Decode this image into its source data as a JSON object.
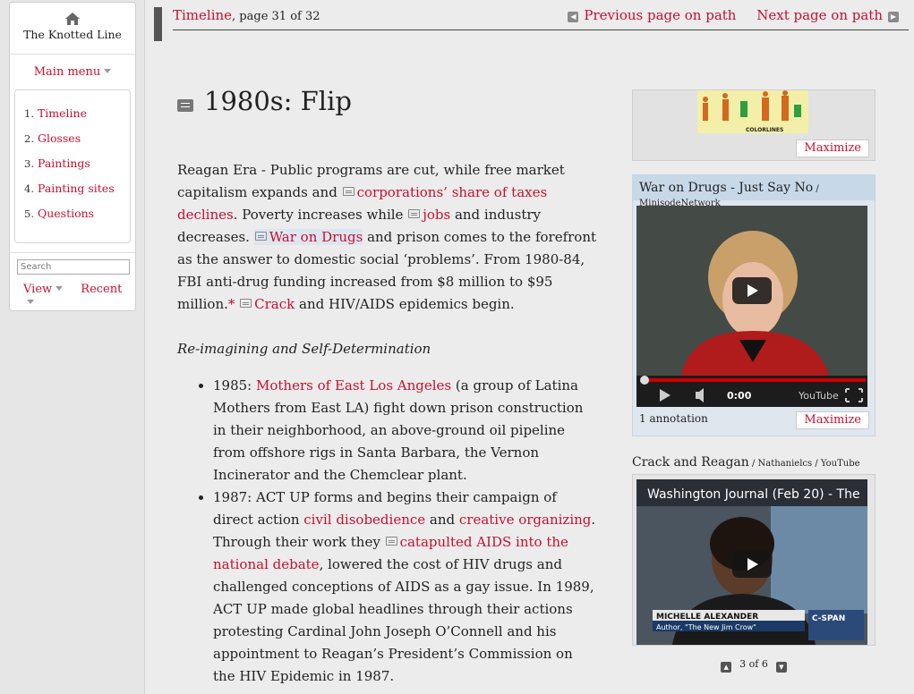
{
  "site": {
    "title": "The Knotted Line",
    "home_icon": "home-icon"
  },
  "sidebar": {
    "main_menu_label": "Main menu",
    "items": [
      {
        "num": "1.",
        "label": "Timeline"
      },
      {
        "num": "2.",
        "label": "Glosses"
      },
      {
        "num": "3.",
        "label": "Paintings"
      },
      {
        "num": "4.",
        "label": "Painting sites"
      },
      {
        "num": "5.",
        "label": "Questions"
      }
    ],
    "search_placeholder": "Search",
    "view_label": "View",
    "recent_label": "Recent"
  },
  "path": {
    "title": "Timeline",
    "page_info": ", page 31 of 32",
    "prev_label": "Previous page on path",
    "next_label": "Next page on path"
  },
  "page": {
    "title": "1980s: Flip"
  },
  "body": {
    "p1_a": "Reagan Era - Public programs are cut, while free market capitalism expands and ",
    "p1_link1": "corporations’ share of taxes declines",
    "p1_b": ". Poverty increases while ",
    "p1_link2": "jobs",
    "p1_c": " and industry decreases. ",
    "p1_link3": "War on Drugs",
    "p1_d": " and prison comes to the forefront as the answer to domestic social ‘problems’. From 1980-84, FBI anti-drug funding increased from $8 million to $95 million.",
    "p1_star": "*",
    "p1_link4": "Crack",
    "p1_e": " and HIV/AIDS epidemics begin.",
    "subheading": "Re-imagining and Self-Determination",
    "e1_a": "1985: ",
    "e1_link": "Mothers of East Los Angeles",
    "e1_b": " (a group of Latina Mothers from East LA) fight down prison construction in their neighborhood, an above-ground oil pipeline from offshore rigs in Santa Barbara, the Vernon Incinerator and the Chemclear plant.",
    "e2_a": "1987: ACT UP forms and begins their campaign of direct action ",
    "e2_link1": "civil disobedience",
    "e2_b": " and ",
    "e2_link2": "creative organizing",
    "e2_c": ".  Through their work they ",
    "e2_link3": "catapulted AIDS into the national debate",
    "e2_d": ", lowered the cost of HIV drugs and challenged conceptions of AIDS as a gay issue.  In 1989, ACT UP made global headlines through their actions protesting Cardinal John Joseph O’Connell and his appointment to Reagan’s President’s Commission on the HIV Epidemic in 1987."
  },
  "right": {
    "chart_thumb_text": "COLORLINES",
    "maximize_label": "Maximize",
    "video1_title": "War on Drugs - Just Say No",
    "video1_source": " / MinisodeNetwork",
    "video1_time": "0:00",
    "video1_brand": "YouTube",
    "video1_annotation": "1 annotation",
    "video2_title": "Crack and Reagan",
    "video2_source": " / Nathanielcs / YouTube",
    "video2_overlay_title": "Washington Journal (Feb 20) - The",
    "video2_lower_name": "MICHELLE ALEXANDER",
    "video2_lower_sub": "Author, \"The New Jim Crow\"",
    "video2_network": "C-SPAN",
    "pager_text": "3 of 6"
  },
  "colors": {
    "accent": "#c8102e",
    "panel_blue": "#c7d8e8"
  }
}
